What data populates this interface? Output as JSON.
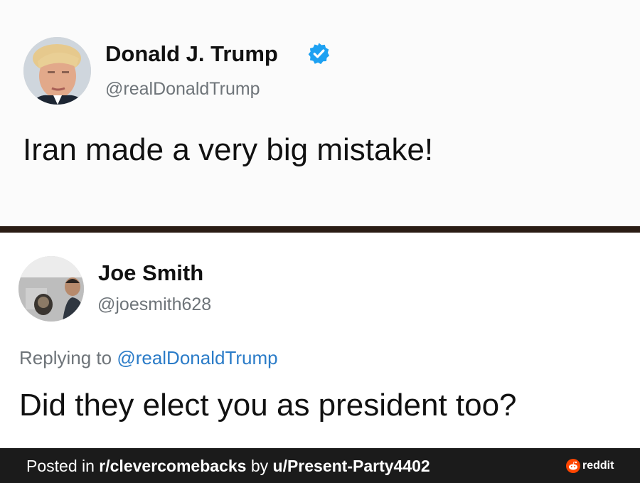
{
  "tweet1": {
    "name": "Donald J. Trump",
    "handle": "@realDonaldTrump",
    "text": "Iran made a very big mistake!",
    "verified_badge_icon": "verified-check-icon"
  },
  "tweet2": {
    "name": "Joe Smith",
    "handle": "@joesmith628",
    "replying_prefix": "Replying to ",
    "replying_to": "@realDonaldTrump",
    "text": "Did they elect you as president too?"
  },
  "footer": {
    "posted_in_prefix": "Posted in ",
    "subreddit": "r/clevercomebacks",
    "by_prefix": " by ",
    "user": "u/Present-Party4402",
    "brand": "reddit"
  },
  "colors": {
    "verified": "#1da1f2",
    "mention": "#2b7cc8",
    "divider": "#2a1c14",
    "footer_bg": "#1b1b1b",
    "reddit_orange": "#ff4500"
  }
}
